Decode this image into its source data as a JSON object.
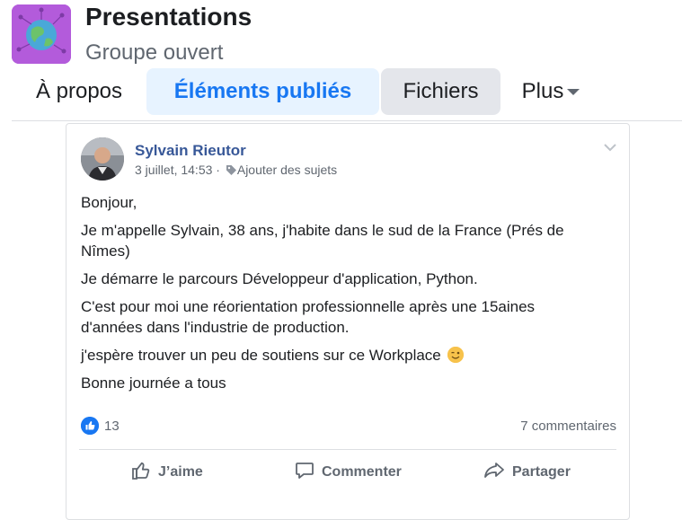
{
  "group": {
    "title": "Presentations",
    "subtitle": "Groupe ouvert"
  },
  "tabs": [
    {
      "label": "À propos",
      "active": false
    },
    {
      "label": "Éléments publiés",
      "active": true
    },
    {
      "label": "Fichiers",
      "active": false
    },
    {
      "label": "Plus",
      "active": false
    }
  ],
  "post": {
    "author": "Sylvain Rieutor",
    "timestamp": "3 juillet, 14:53",
    "separator": "·",
    "add_topics": "Ajouter des sujets",
    "paragraphs": [
      "Bonjour,",
      "Je m'appelle Sylvain, 38 ans, j'habite dans le sud de la France (Prés de Nîmes)",
      "Je démarre le parcours Développeur d'application, Python.",
      "C'est pour moi une réorientation professionnelle après une 15aines d'années dans l'industrie de production.",
      "j'espère trouver un peu de soutiens sur ce Workplace",
      "Bonne journée a tous"
    ],
    "reactions_count": "13",
    "comments_count": "7 commentaires",
    "actions": {
      "like": "J’aime",
      "comment": "Commenter",
      "share": "Partager"
    }
  },
  "colors": {
    "accent": "#1877f2",
    "author_link": "#385898",
    "active_tab_bg": "#e7f3ff",
    "files_tab_bg": "#e4e6eb"
  },
  "icons": {
    "group_icon": "globe-network-icon",
    "tag": "tag-icon",
    "chevron": "chevron-down-icon",
    "like_reaction": "thumbs-up-icon",
    "emoji": "winking-face-icon"
  }
}
